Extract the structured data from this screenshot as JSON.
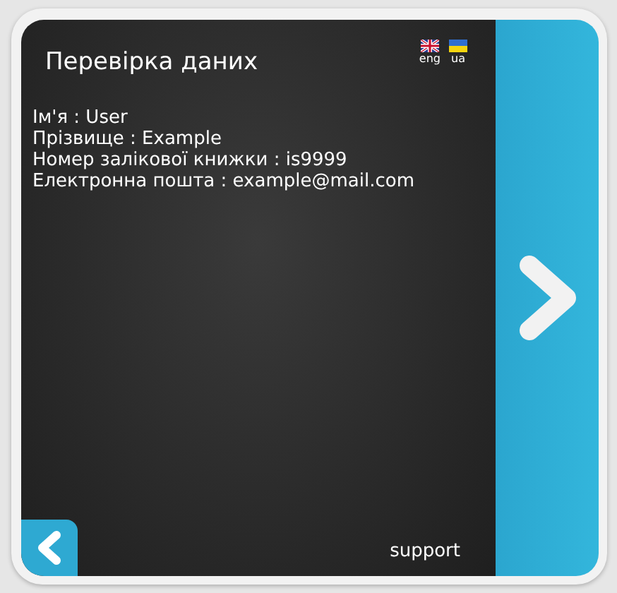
{
  "title": "Перевірка даних",
  "languages": [
    {
      "label": "eng",
      "kind": "gb"
    },
    {
      "label": "ua",
      "kind": "ua"
    }
  ],
  "details": [
    "Ім'я : User",
    "Прізвище : Example",
    "Номер залікової книжки : is9999",
    "Електронна пошта : example@mail.com"
  ],
  "support": "support"
}
